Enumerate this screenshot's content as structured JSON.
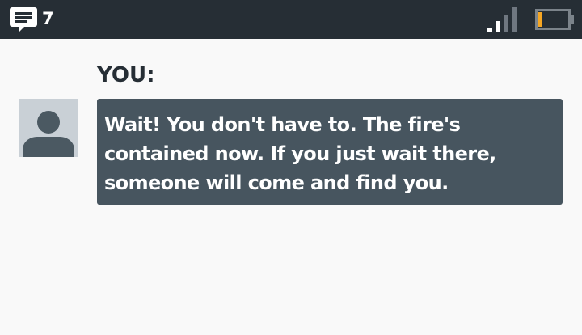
{
  "status_bar": {
    "message_count": "7",
    "battery_color": "#f5a623",
    "icons": [
      "message-icon",
      "signal-icon",
      "battery-icon"
    ]
  },
  "conversation": {
    "sender_label": "YOU:",
    "message_text": "Wait! You don't have to. The fire's\ncontained now. If you just wait there,\nsomeone will come and find you."
  },
  "colors": {
    "status_bar_bg": "#262e35",
    "bubble_bg": "#47555f",
    "page_bg": "#f9f9f9",
    "avatar_bg": "#c9d0d6",
    "avatar_fg": "#4b5962"
  }
}
